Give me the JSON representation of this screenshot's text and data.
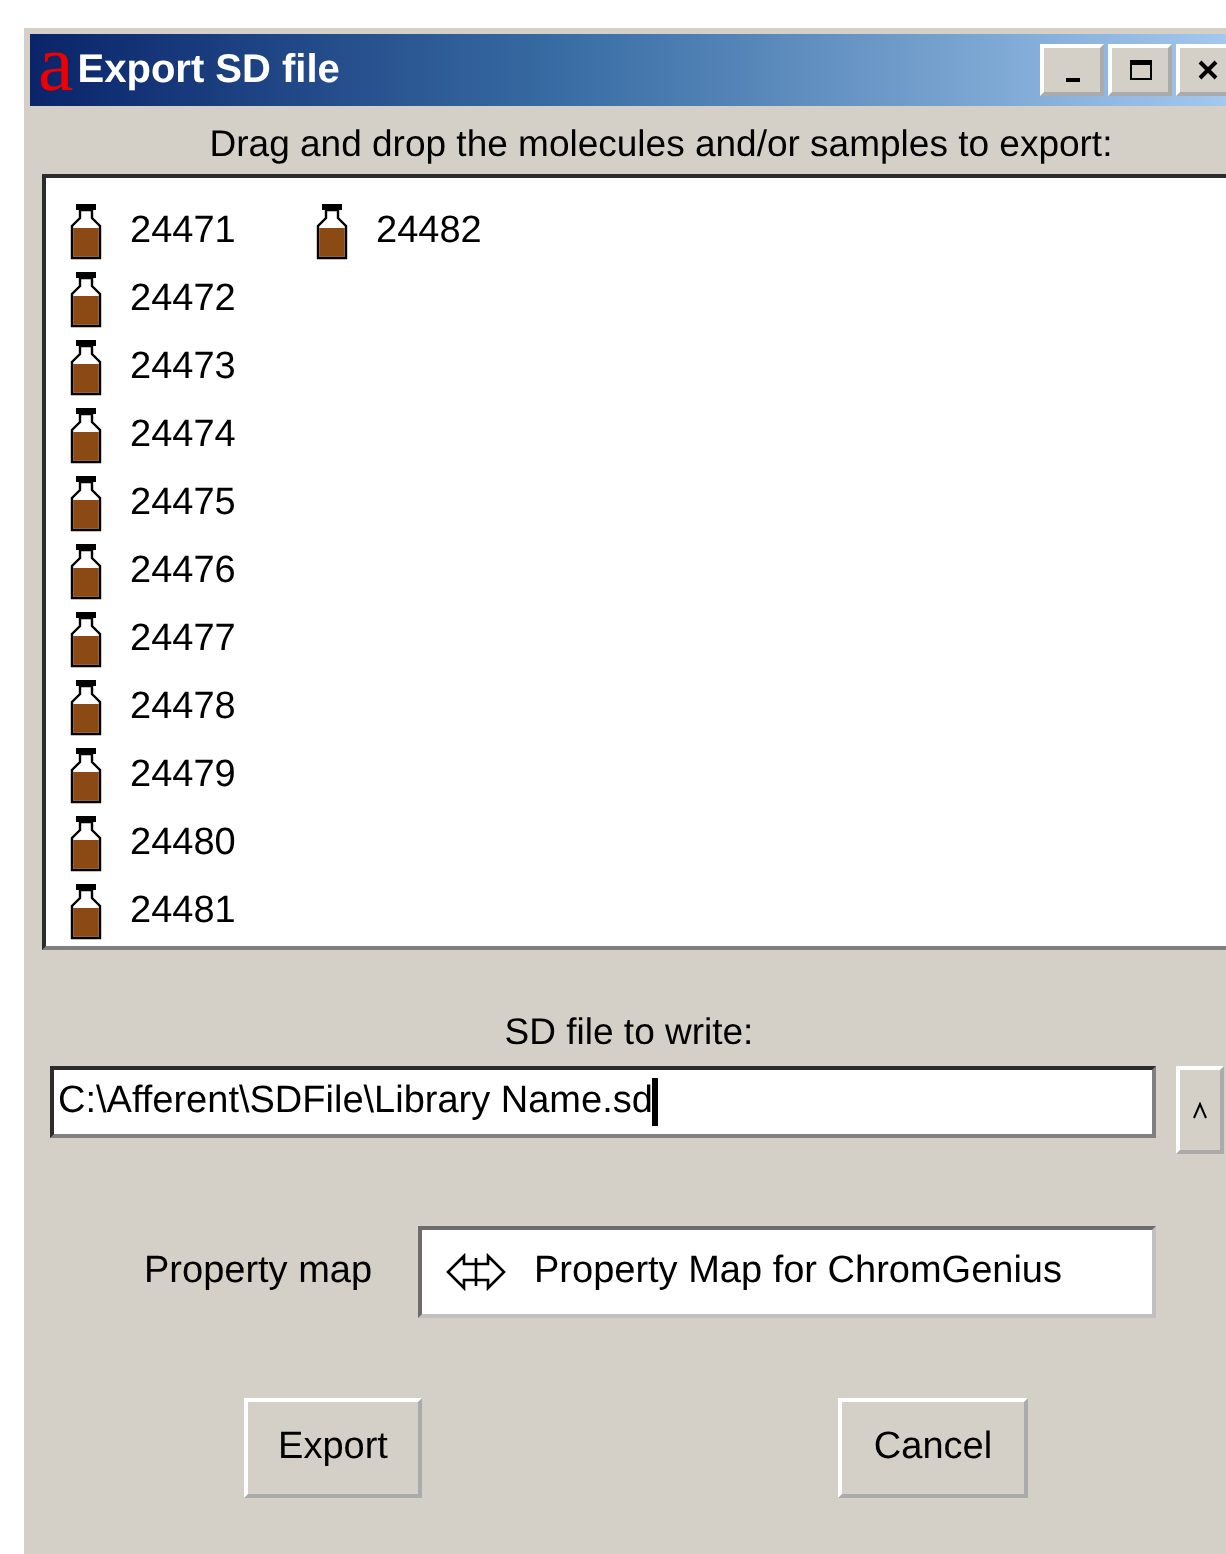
{
  "window": {
    "logo": "a",
    "title": "Export SD file"
  },
  "instruction": "Drag and drop the molecules and/or samples to export:",
  "samples": [
    {
      "label": "24471"
    },
    {
      "label": "24472"
    },
    {
      "label": "24473"
    },
    {
      "label": "24474"
    },
    {
      "label": "24475"
    },
    {
      "label": "24476"
    },
    {
      "label": "24477"
    },
    {
      "label": "24478"
    },
    {
      "label": "24479"
    },
    {
      "label": "24480"
    },
    {
      "label": "24481"
    },
    {
      "label": "24482"
    }
  ],
  "file_label": "SD file to write:",
  "file_value": "C:\\Afferent\\SDFile\\Library Name.sd",
  "property_map": {
    "label": "Property map",
    "value": "Property Map for ChromGenius"
  },
  "buttons": [
    "Export",
    "Cancel"
  ]
}
